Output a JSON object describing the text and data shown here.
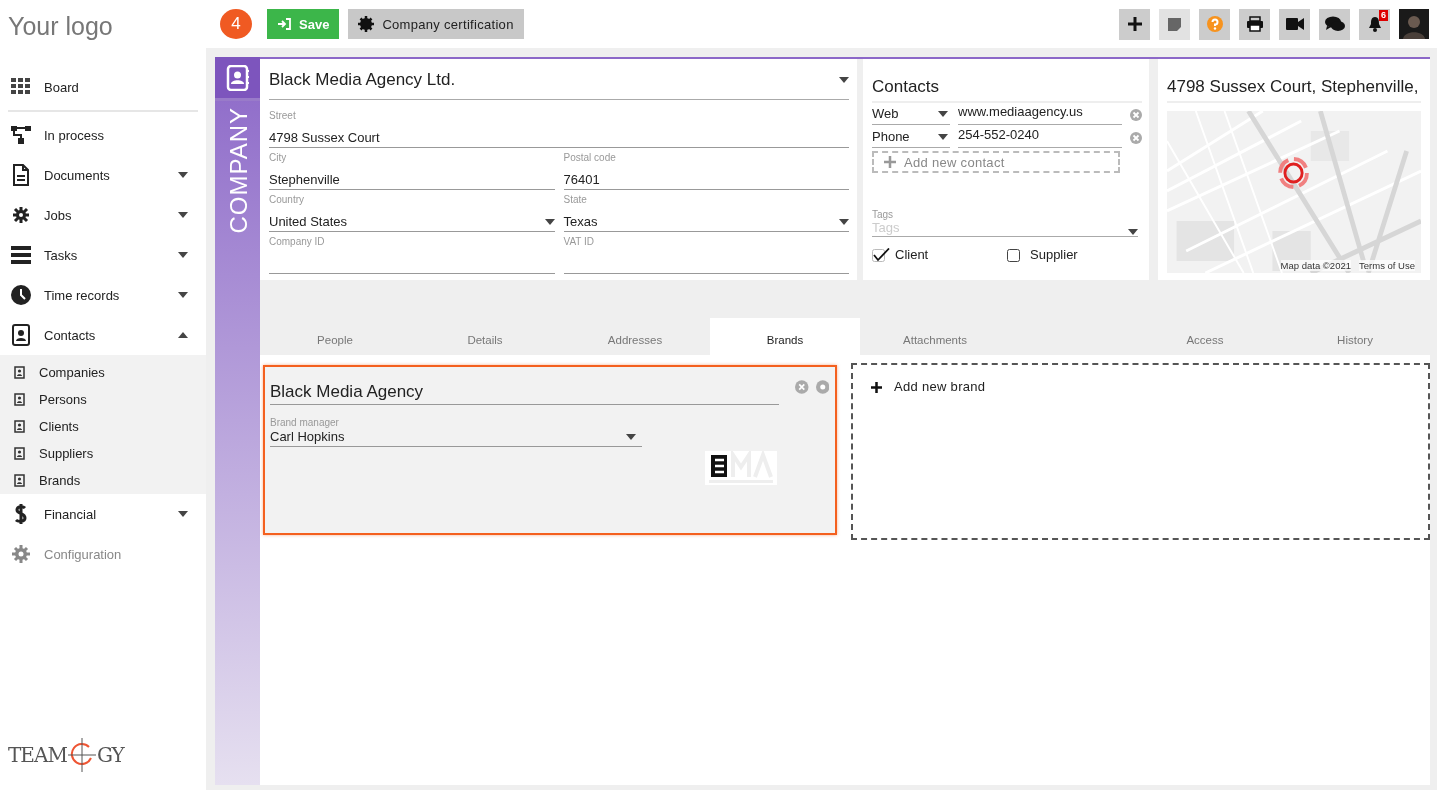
{
  "logo": "Your logo",
  "sidebar": {
    "items": [
      {
        "kind": "link",
        "label": "Board",
        "disabled": false,
        "separator_below": true
      },
      {
        "kind": "link",
        "label": "In process",
        "disabled": false
      },
      {
        "kind": "group",
        "label": "Documents",
        "expanded": false,
        "disabled": false
      },
      {
        "kind": "group",
        "label": "Jobs",
        "expanded": false,
        "disabled": false
      },
      {
        "kind": "group",
        "label": "Tasks",
        "expanded": false,
        "disabled": false
      },
      {
        "kind": "group",
        "label": "Time records",
        "expanded": false,
        "disabled": false
      },
      {
        "kind": "group",
        "label": "Contacts",
        "expanded": true,
        "disabled": false,
        "children": [
          {
            "label": "Companies"
          },
          {
            "label": "Persons"
          },
          {
            "label": "Clients"
          },
          {
            "label": "Suppliers"
          },
          {
            "label": "Brands"
          }
        ]
      },
      {
        "kind": "group",
        "label": "Financial",
        "expanded": false,
        "disabled": false
      },
      {
        "kind": "link",
        "label": "Configuration",
        "disabled": true
      }
    ]
  },
  "footer_logo": {
    "left": "TEAM",
    "right": "GY"
  },
  "topbar": {
    "badge": "4",
    "save_button": "Save",
    "certification_button": "Company certification",
    "notifications": "6"
  },
  "company": {
    "side_label": "COMPANY",
    "name": "Black Media Agency Ltd.",
    "rows": [
      [
        {
          "label": "Street",
          "value": "4798  Sussex Court",
          "kind": "text"
        }
      ],
      [
        {
          "label": "City",
          "value": "Stephenville",
          "kind": "text"
        },
        {
          "label": "Postal code",
          "value": "76401",
          "kind": "text"
        }
      ],
      [
        {
          "label": "Country",
          "value": "United States",
          "kind": "select"
        },
        {
          "label": "State",
          "value": "Texas",
          "kind": "select"
        }
      ],
      [
        {
          "label": "Company ID",
          "kind": "text"
        },
        {
          "label": "VAT ID",
          "kind": "text"
        }
      ]
    ]
  },
  "contacts": {
    "title": "Contacts",
    "entries": [
      {
        "type": "Web",
        "value": "www.mediaagency.us"
      },
      {
        "type": "Phone",
        "value": "254-552-0240"
      }
    ],
    "add_button": "Add new contact",
    "tags": {
      "label": "Tags",
      "placeholder": "Tags"
    },
    "checkboxes": [
      {
        "label": "Client",
        "checked": true
      },
      {
        "label": "Supplier",
        "checked": false
      }
    ]
  },
  "map": {
    "address": "4798 Sussex Court, Stephenville,",
    "attribution": "Map data ©2021",
    "terms": "Terms of Use"
  },
  "tabs": {
    "left": [
      {
        "label": "People",
        "selected": false
      },
      {
        "label": "Details",
        "selected": false
      },
      {
        "label": "Addresses",
        "selected": false
      },
      {
        "label": "Brands",
        "selected": true
      },
      {
        "label": "Attachments",
        "selected": false
      }
    ],
    "right": [
      {
        "label": "Access",
        "selected": false
      },
      {
        "label": "History",
        "selected": false
      }
    ]
  },
  "brands": {
    "items": [
      {
        "name": "Black Media Agency",
        "manager_label": "Brand manager",
        "manager": "Carl Hopkins",
        "selected": true
      }
    ],
    "add_button": "Add new brand"
  }
}
